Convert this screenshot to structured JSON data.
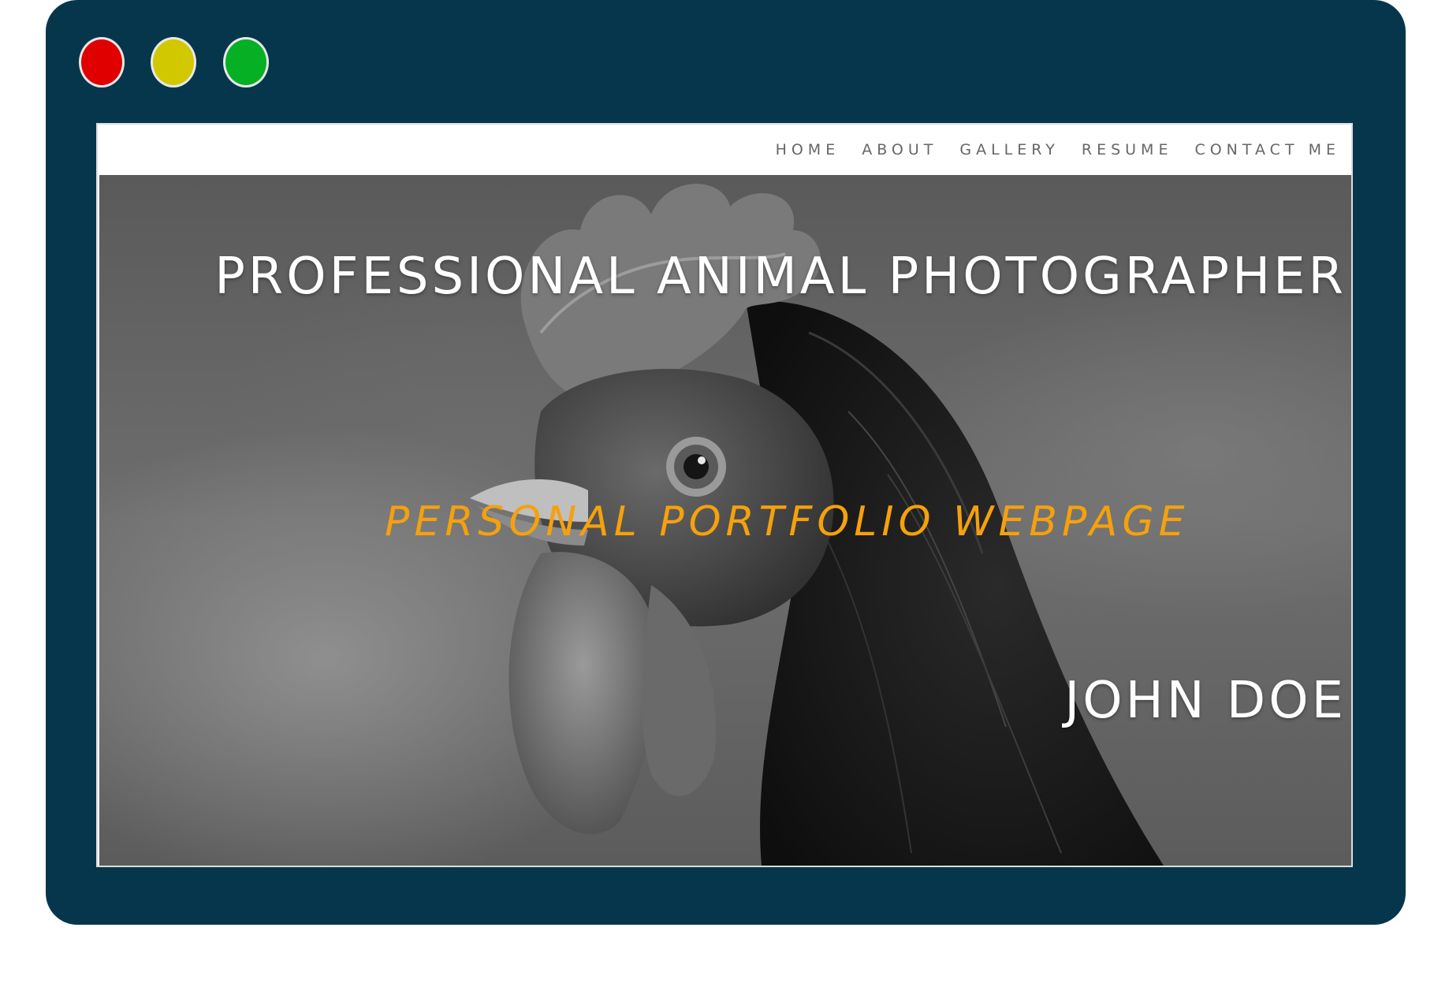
{
  "window": {
    "frame_color": "#06364b",
    "controls": [
      {
        "name": "close",
        "color": "#e00000"
      },
      {
        "name": "minimize",
        "color": "#d1c800"
      },
      {
        "name": "maximize",
        "color": "#05b024"
      }
    ]
  },
  "nav": {
    "items": [
      {
        "label": "HOME"
      },
      {
        "label": "ABOUT"
      },
      {
        "label": "GALLERY"
      },
      {
        "label": "RESUME"
      },
      {
        "label": "CONTACT ME"
      }
    ]
  },
  "hero": {
    "image": "rooster-portrait-bw-photo",
    "title": "PROFESSIONAL ANIMAL PHOTOGRAPHER",
    "subtitle": "PERSONAL PORTFOLIO WEBPAGE",
    "subtitle_color": "#f5a10d",
    "name": "JOHN DOE"
  }
}
